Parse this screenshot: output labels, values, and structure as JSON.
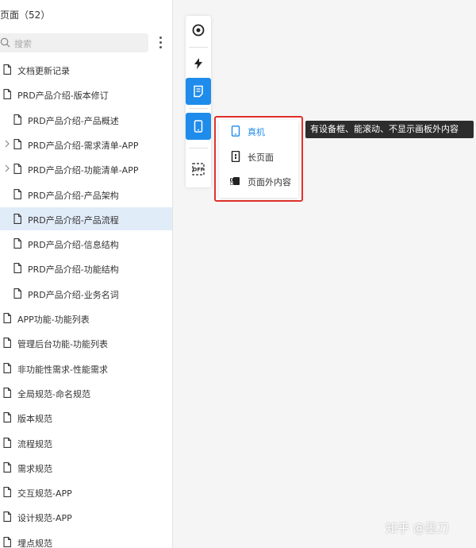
{
  "pages_panel": {
    "header": "页面（52）",
    "search_placeholder": "搜索",
    "items": [
      {
        "label": "文档更新记录",
        "level": 0
      },
      {
        "label": "PRD产品介绍-版本修订",
        "level": 0
      },
      {
        "label": "PRD产品介绍-产品概述",
        "level": 1
      },
      {
        "label": "PRD产品介绍-需求清单-APP",
        "level": 1,
        "collapsed": true
      },
      {
        "label": "PRD产品介绍-功能清单-APP",
        "level": 1,
        "collapsed": true
      },
      {
        "label": "PRD产品介绍-产品架构",
        "level": 1
      },
      {
        "label": "PRD产品介绍-产品流程",
        "level": 1,
        "selected": true
      },
      {
        "label": "PRD产品介绍-信息结构",
        "level": 1
      },
      {
        "label": "PRD产品介绍-功能结构",
        "level": 1
      },
      {
        "label": "PRD产品介绍-业务名词",
        "level": 1
      },
      {
        "label": "APP功能-功能列表",
        "level": 0
      },
      {
        "label": "管理后台功能-功能列表",
        "level": 0
      },
      {
        "label": "非功能性需求-性能需求",
        "level": 0
      },
      {
        "label": "全局规范-命名规范",
        "level": 0
      },
      {
        "label": "版本规范",
        "level": 0
      },
      {
        "label": "流程规范",
        "level": 0
      },
      {
        "label": "需求规范",
        "level": 0
      },
      {
        "label": "交互规范-APP",
        "level": 0
      },
      {
        "label": "设计规范-APP",
        "level": 0
      },
      {
        "label": "埋点规范",
        "level": 0
      }
    ]
  },
  "toolbar": {
    "buttons": [
      {
        "icon": "target-icon",
        "active": false
      },
      {
        "icon": "lightning-icon",
        "active": false
      },
      {
        "icon": "note-icon",
        "active": true
      },
      {
        "icon": "phone-icon",
        "active": true
      },
      {
        "icon": "off-icon",
        "active": false
      }
    ]
  },
  "device_menu": {
    "items": [
      {
        "label": "真机",
        "icon": "phone-icon",
        "selected": true
      },
      {
        "label": "长页面",
        "icon": "long-page-icon",
        "selected": false
      },
      {
        "label": "页面外内容",
        "icon": "outside-content-icon",
        "selected": false
      }
    ],
    "highlight_color": "#e0302a"
  },
  "tooltip": "有设备框、能滚动、不显示画板外内容",
  "watermark": "知乎 @墨刀",
  "colors": {
    "accent": "#1f8ceb",
    "selected_row": "#e1ecf9"
  }
}
